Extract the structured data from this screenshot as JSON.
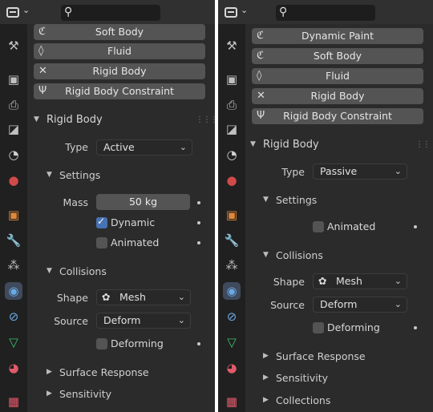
{
  "search": {
    "placeholder": ""
  },
  "icons": {
    "editor": "properties-editor-icon",
    "search": "search-icon"
  },
  "tab_icons": [
    "tool-icon",
    "render-icon",
    "output-icon",
    "view-layer-icon",
    "scene-icon",
    "world-icon",
    "object-icon",
    "modifier-icon",
    "particles-icon",
    "physics-icon",
    "constraint-icon",
    "data-icon",
    "material-icon",
    "texture-icon"
  ],
  "colors": {
    "active_tab": "#3f4a5c",
    "checkbox_on": "#4772b3"
  },
  "left": {
    "buttons": [
      "Soft Body",
      "Fluid",
      "Rigid Body",
      "Rigid Body Constraint"
    ],
    "panel_title": "Rigid Body",
    "type_label": "Type",
    "type_value": "Active",
    "settings_title": "Settings",
    "mass_label": "Mass",
    "mass_value": "50 kg",
    "dynamic_label": "Dynamic",
    "dynamic_checked": true,
    "animated_label": "Animated",
    "animated_checked": false,
    "collisions_title": "Collisions",
    "shape_label": "Shape",
    "shape_value": "Mesh",
    "source_label": "Source",
    "source_value": "Deform",
    "deforming_label": "Deforming",
    "deforming_checked": false,
    "surface_title": "Surface Response",
    "sensitivity_title": "Sensitivity"
  },
  "right": {
    "buttons": [
      "Dynamic Paint",
      "Soft Body",
      "Fluid",
      "Rigid Body",
      "Rigid Body Constraint"
    ],
    "panel_title": "Rigid Body",
    "type_label": "Type",
    "type_value": "Passive",
    "settings_title": "Settings",
    "animated_label": "Animated",
    "animated_checked": false,
    "collisions_title": "Collisions",
    "shape_label": "Shape",
    "shape_value": "Mesh",
    "source_label": "Source",
    "source_value": "Deform",
    "deforming_label": "Deforming",
    "deforming_checked": false,
    "surface_title": "Surface Response",
    "sensitivity_title": "Sensitivity",
    "collections_title": "Collections"
  }
}
